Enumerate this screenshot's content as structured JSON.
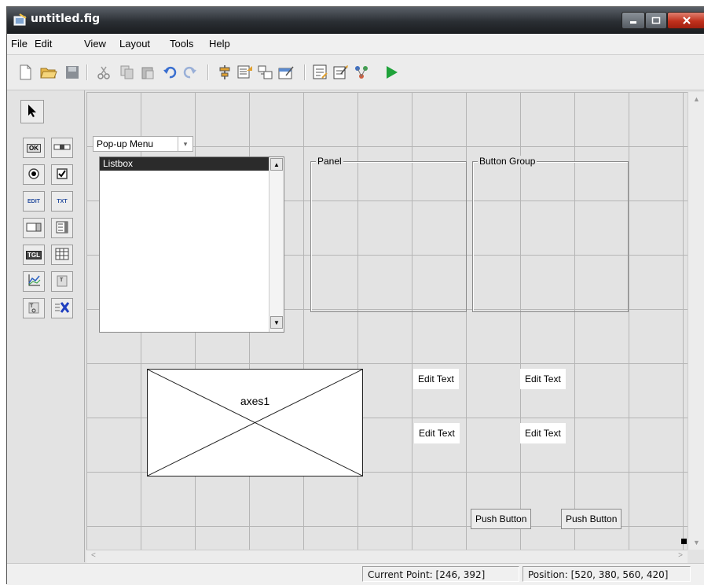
{
  "window": {
    "title": "untitled.fig"
  },
  "menu": [
    "File",
    "Edit",
    "View",
    "Layout",
    "Tools",
    "Help"
  ],
  "toolbar": [
    "new-icon",
    "open-icon",
    "save-icon",
    "cut-icon",
    "copy-icon",
    "paste-icon",
    "undo-icon",
    "redo-icon",
    "align-icon",
    "menu-editor-icon",
    "tab-order-icon",
    "toolbar-editor-icon",
    "mfile-editor-icon",
    "property-inspector-icon",
    "object-browser-icon",
    "run-icon"
  ],
  "palette": {
    "select": "arrow-icon",
    "labels": {
      "push": "OK",
      "edit": "EDIT",
      "static": "TXT",
      "toggle": "TGL",
      "panel_t": "T"
    }
  },
  "canvas": {
    "popup": {
      "label": "Pop-up Menu"
    },
    "listbox": {
      "item": "Listbox"
    },
    "panel": {
      "title": "Panel"
    },
    "button_group": {
      "title": "Button Group"
    },
    "axes": {
      "label": "axes1"
    },
    "edit_texts": [
      "Edit Text",
      "Edit Text",
      "Edit Text",
      "Edit Text"
    ],
    "push_buttons": [
      "Push Button",
      "Push Button"
    ]
  },
  "status": {
    "current_point": "Current Point:  [246, 392]",
    "position": "Position: [520, 380, 560, 420]"
  },
  "colors": {
    "run": "#1fa23a",
    "titlebar": "#2a2e33",
    "close": "#c0301c"
  }
}
